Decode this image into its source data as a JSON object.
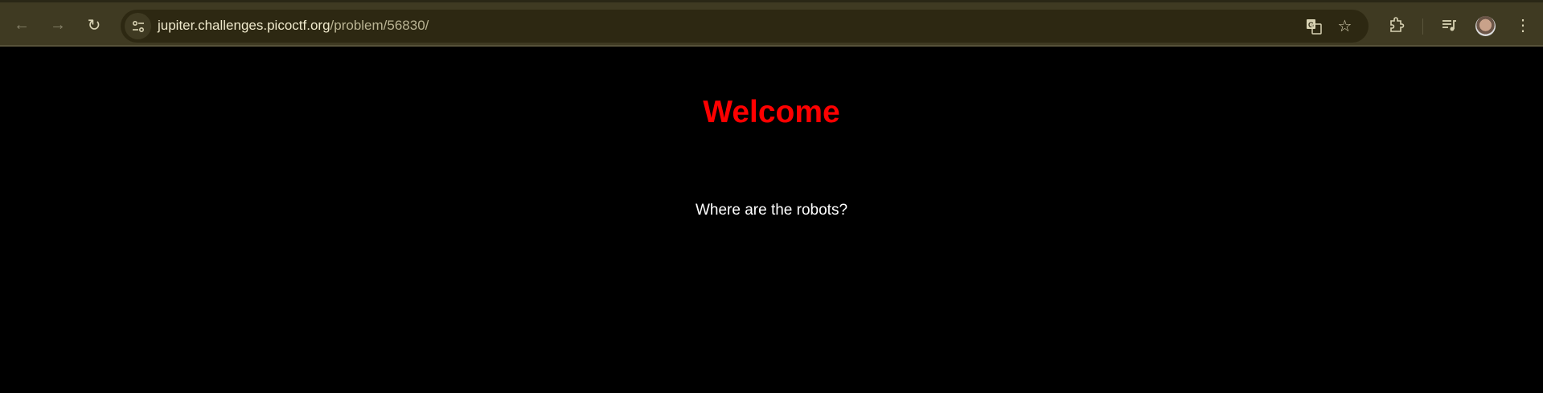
{
  "browser": {
    "url_host": "jupiter.challenges.picoctf.org",
    "url_path": "/problem/56830/",
    "icons": [
      "back-arrow-icon",
      "forward-arrow-icon",
      "reload-icon",
      "site-settings-icon",
      "translate-icon",
      "bookmark-star-icon",
      "extensions-icon",
      "media-controls-icon",
      "profile-avatar",
      "more-menu-icon"
    ]
  },
  "page": {
    "heading": "Welcome",
    "text": "Where are the robots?",
    "heading_color": "#ff0000",
    "background_color": "#000000"
  }
}
